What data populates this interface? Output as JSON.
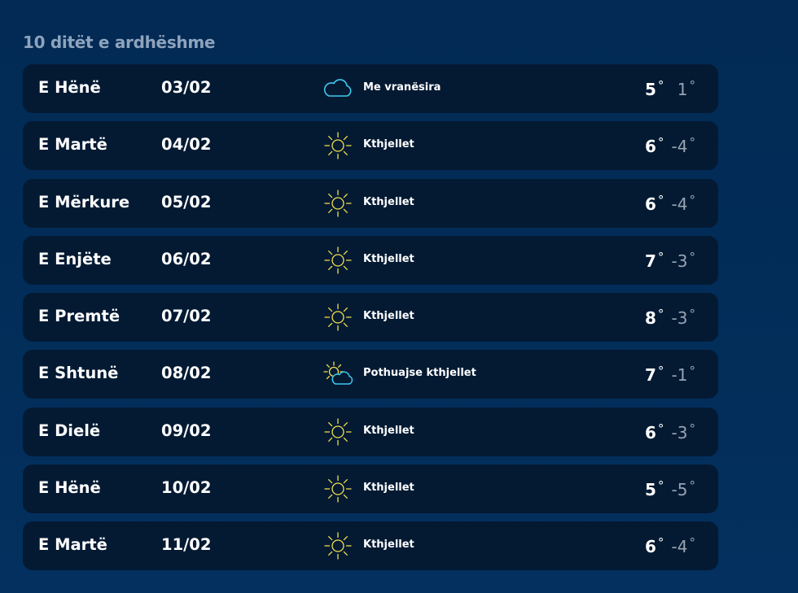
{
  "heading": "10 ditët e ardhëshme",
  "degree_symbol": "°",
  "colors": {
    "background": "#022a54",
    "row_background": "#041a33",
    "sun_icon": "#f4e04d",
    "cloud_icon": "#3ec8ee",
    "min_temp": "#98a4b3"
  },
  "days": [
    {
      "day": "E Hënë",
      "date": "03/02",
      "icon": "cloud-icon",
      "condition": "Me vranësira",
      "max": "5",
      "min": "1"
    },
    {
      "day": "E Martë",
      "date": "04/02",
      "icon": "sun-icon",
      "condition": "Kthjellet",
      "max": "6",
      "min": "-4"
    },
    {
      "day": "E Mërkure",
      "date": "05/02",
      "icon": "sun-icon",
      "condition": "Kthjellet",
      "max": "6",
      "min": "-4"
    },
    {
      "day": "E Enjëte",
      "date": "06/02",
      "icon": "sun-icon",
      "condition": "Kthjellet",
      "max": "7",
      "min": "-3"
    },
    {
      "day": "E Premtë",
      "date": "07/02",
      "icon": "sun-icon",
      "condition": "Kthjellet",
      "max": "8",
      "min": "-3"
    },
    {
      "day": "E Shtunë",
      "date": "08/02",
      "icon": "partly-cloudy-icon",
      "condition": "Pothuajse kthjellet",
      "max": "7",
      "min": "-1"
    },
    {
      "day": "E Dielë",
      "date": "09/02",
      "icon": "sun-icon",
      "condition": "Kthjellet",
      "max": "6",
      "min": "-3"
    },
    {
      "day": "E Hënë",
      "date": "10/02",
      "icon": "sun-icon",
      "condition": "Kthjellet",
      "max": "5",
      "min": "-5"
    },
    {
      "day": "E Martë",
      "date": "11/02",
      "icon": "sun-icon",
      "condition": "Kthjellet",
      "max": "6",
      "min": "-4"
    }
  ]
}
